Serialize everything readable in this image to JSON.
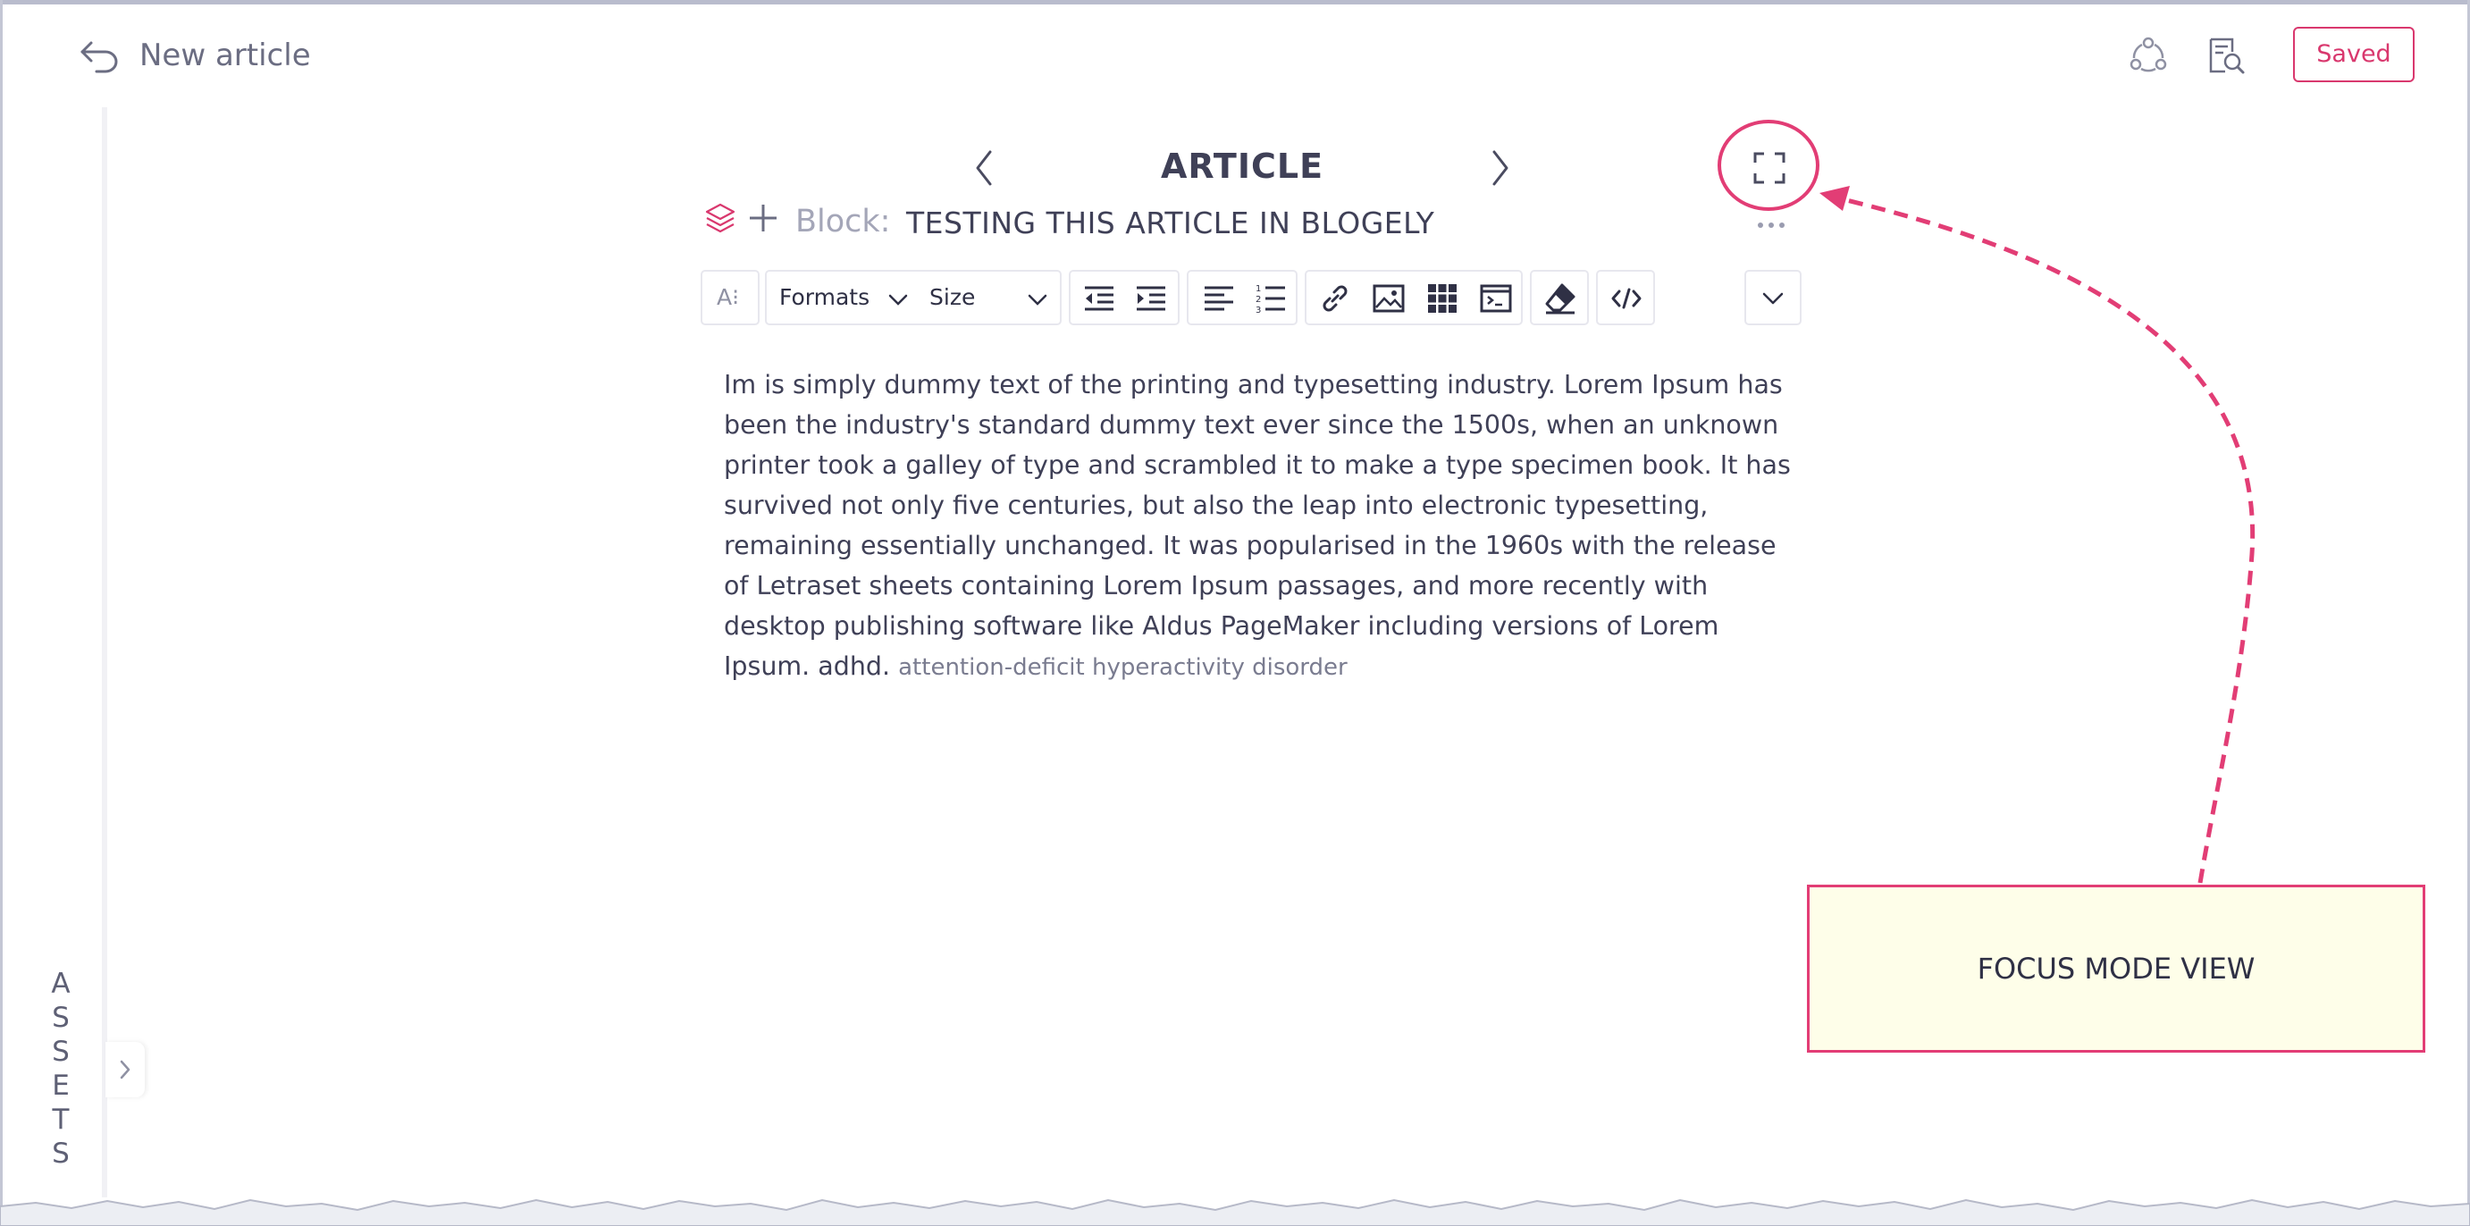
{
  "header": {
    "title": "New article",
    "saved_label": "Saved"
  },
  "sidebar": {
    "assets_letters": [
      "A",
      "S",
      "S",
      "E",
      "T",
      "S"
    ]
  },
  "article": {
    "heading": "ARTICLE",
    "block_label": "Block:",
    "block_title": "TESTING THIS ARTICLE IN BLOGELY",
    "body": "Im is simply dummy text of the printing and typesetting industry. Lorem Ipsum has been the industry's standard dummy text ever since the 1500s, when an unknown printer took a galley of type and scrambled it to make a type specimen book. It has survived not only five centuries, but also the leap into electronic typesetting, remaining essentially unchanged. It was popularised in the 1960s with the release of Letraset sheets containing Lorem Ipsum passages, and more recently with desktop publishing software like Aldus PageMaker including versions of Lorem Ipsum. adhd.",
    "body_tail": "attention-deficit hyperactivity disorder"
  },
  "toolbar": {
    "formats_label": "Formats",
    "size_label": "Size",
    "font_icon_text": "A⁝"
  },
  "callout": {
    "text": "FOCUS MODE VIEW"
  },
  "colors": {
    "accent": "#d9386e",
    "text": "#3f4057",
    "callout_bg": "#fefee9"
  },
  "icons": [
    "back-icon",
    "share-icon",
    "preview-icon",
    "chevron-left-icon",
    "chevron-right-icon",
    "focus-mode-icon",
    "layers-icon",
    "plus-icon",
    "more-icon",
    "outdent-icon",
    "indent-icon",
    "align-left-icon",
    "numbered-list-icon",
    "link-icon",
    "image-icon",
    "table-icon",
    "code-block-icon",
    "eraser-icon",
    "source-code-icon",
    "chevron-down-icon"
  ]
}
